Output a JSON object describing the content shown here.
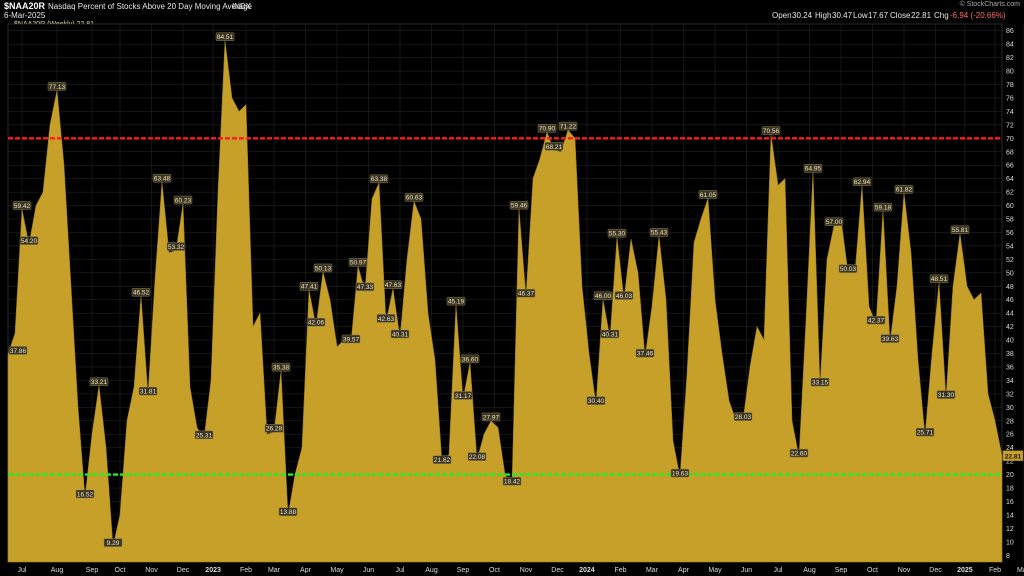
{
  "header": {
    "symbol": "$NAA20R",
    "title": "Nasdaq Percent of Stocks Above 20 Day Moving Average",
    "exchange": "INDX",
    "date": "6-Mar-2025",
    "watermark": "© StockCharts.com",
    "ohlc": {
      "open_label": "Open",
      "open": "30.24",
      "high_label": "High",
      "high": "30.47",
      "low_label": "Low",
      "low": "17.67",
      "close_label": "Close",
      "close": "22.81",
      "chg_label": "Chg",
      "chg": "-6.94 (-20.66%)"
    },
    "legend": "$NAA20R (Weekly) 22.81"
  },
  "chart_data": {
    "type": "area",
    "series": [
      {
        "name": "$NAA20R (Weekly)",
        "color": "#c7a02a",
        "values": [
          37.86,
          41,
          59.42,
          54.2,
          60,
          62,
          72,
          77.13,
          66,
          48,
          30,
          16.52,
          26,
          33.21,
          24,
          9.29,
          14,
          28,
          33,
          46.52,
          31.81,
          49,
          63.48,
          53,
          53.32,
          60.23,
          33,
          27,
          25.31,
          34,
          62,
          84.51,
          76,
          74,
          75,
          42,
          44,
          26,
          26.28,
          35.38,
          13.88,
          20,
          24,
          47.41,
          42.06,
          50.13,
          46,
          39,
          40,
          39.57,
          50.97,
          47.33,
          61,
          63.38,
          42.63,
          47.63,
          40.31,
          52,
          60.63,
          58,
          44,
          37,
          21.62,
          23,
          45.19,
          31.17,
          36.6,
          22.08,
          26,
          27.97,
          27,
          20,
          18.42,
          59.46,
          46.37,
          64,
          67,
          70.9,
          68.21,
          68,
          71.22,
          70,
          48,
          38,
          30.4,
          46.0,
          40.31,
          55.3,
          46.03,
          55,
          50,
          37.46,
          45,
          55.43,
          46,
          25,
          19.63,
          35,
          54.5,
          58,
          61.05,
          46,
          38,
          31,
          28,
          28.03,
          36,
          42,
          40,
          70.56,
          63,
          64,
          28,
          22.6,
          43,
          64.95,
          33.15,
          52,
          57.0,
          58,
          50.03,
          50,
          62.94,
          45,
          42.37,
          59.18,
          39.63,
          48,
          61.82,
          53,
          37,
          25.71,
          38,
          48.51,
          31.3,
          48,
          55.81,
          48,
          46,
          47,
          32,
          28,
          22.81
        ]
      }
    ],
    "data_labels": [
      {
        "i": 0,
        "v": "37.86"
      },
      {
        "i": 2,
        "v": "59.42"
      },
      {
        "i": 3,
        "v": "54.20"
      },
      {
        "i": 7,
        "v": "77.13"
      },
      {
        "i": 11,
        "v": "16.52"
      },
      {
        "i": 13,
        "v": "33.21"
      },
      {
        "i": 15,
        "v": "9.29"
      },
      {
        "i": 19,
        "v": "46.52"
      },
      {
        "i": 20,
        "v": "31.81"
      },
      {
        "i": 22,
        "v": "63.48"
      },
      {
        "i": 24,
        "v": "53.32"
      },
      {
        "i": 25,
        "v": "60.23"
      },
      {
        "i": 28,
        "v": "25.31"
      },
      {
        "i": 31,
        "v": "84.51"
      },
      {
        "i": 38,
        "v": "26.28"
      },
      {
        "i": 39,
        "v": "35.38"
      },
      {
        "i": 40,
        "v": "13.88"
      },
      {
        "i": 43,
        "v": "47.41"
      },
      {
        "i": 44,
        "v": "42.06"
      },
      {
        "i": 45,
        "v": "50.13"
      },
      {
        "i": 49,
        "v": "39.57"
      },
      {
        "i": 50,
        "v": "50.97"
      },
      {
        "i": 51,
        "v": "47.33"
      },
      {
        "i": 53,
        "v": "63.38"
      },
      {
        "i": 54,
        "v": "42.63"
      },
      {
        "i": 55,
        "v": "47.63"
      },
      {
        "i": 56,
        "v": "40.31"
      },
      {
        "i": 58,
        "v": "60.63"
      },
      {
        "i": 62,
        "v": "21.62"
      },
      {
        "i": 64,
        "v": "45.19"
      },
      {
        "i": 65,
        "v": "31.17"
      },
      {
        "i": 66,
        "v": "36.60"
      },
      {
        "i": 67,
        "v": "22.08"
      },
      {
        "i": 69,
        "v": "27.97"
      },
      {
        "i": 72,
        "v": "18.42"
      },
      {
        "i": 73,
        "v": "59.46"
      },
      {
        "i": 74,
        "v": "46.37"
      },
      {
        "i": 77,
        "v": "70.90"
      },
      {
        "i": 78,
        "v": "68.21"
      },
      {
        "i": 80,
        "v": "71.22"
      },
      {
        "i": 84,
        "v": "30.40"
      },
      {
        "i": 85,
        "v": "46.00"
      },
      {
        "i": 86,
        "v": "40.31"
      },
      {
        "i": 87,
        "v": "55.30"
      },
      {
        "i": 88,
        "v": "46.03"
      },
      {
        "i": 91,
        "v": "37.46"
      },
      {
        "i": 93,
        "v": "55.43"
      },
      {
        "i": 96,
        "v": "19.63"
      },
      {
        "i": 100,
        "v": "61.05"
      },
      {
        "i": 105,
        "v": "28.03"
      },
      {
        "i": 109,
        "v": "70.56"
      },
      {
        "i": 113,
        "v": "22.60"
      },
      {
        "i": 115,
        "v": "64.95"
      },
      {
        "i": 116,
        "v": "33.15"
      },
      {
        "i": 118,
        "v": "57.00"
      },
      {
        "i": 120,
        "v": "50.03"
      },
      {
        "i": 122,
        "v": "62.94"
      },
      {
        "i": 124,
        "v": "42.37"
      },
      {
        "i": 125,
        "v": "59.18"
      },
      {
        "i": 126,
        "v": "39.63"
      },
      {
        "i": 128,
        "v": "61.82"
      },
      {
        "i": 131,
        "v": "25.71"
      },
      {
        "i": 133,
        "v": "48.51"
      },
      {
        "i": 134,
        "v": "31.30"
      },
      {
        "i": 136,
        "v": "55.81"
      }
    ],
    "last_value_label": "22.81",
    "x_ticks": [
      {
        "label": "Jul",
        "i": 2
      },
      {
        "label": "Aug",
        "i": 7
      },
      {
        "label": "Sep",
        "i": 12
      },
      {
        "label": "Oct",
        "i": 16
      },
      {
        "label": "Nov",
        "i": 20.5
      },
      {
        "label": "Dec",
        "i": 25
      },
      {
        "label": "2023",
        "i": 29.3,
        "bold": true
      },
      {
        "label": "Feb",
        "i": 34
      },
      {
        "label": "Mar",
        "i": 38
      },
      {
        "label": "Apr",
        "i": 42.5
      },
      {
        "label": "May",
        "i": 47
      },
      {
        "label": "Jun",
        "i": 51.5
      },
      {
        "label": "Jul",
        "i": 56
      },
      {
        "label": "Aug",
        "i": 60.5
      },
      {
        "label": "Sep",
        "i": 65
      },
      {
        "label": "Oct",
        "i": 69.5
      },
      {
        "label": "Nov",
        "i": 74
      },
      {
        "label": "Dec",
        "i": 78.5
      },
      {
        "label": "2024",
        "i": 82.7,
        "bold": true
      },
      {
        "label": "Feb",
        "i": 87.5
      },
      {
        "label": "Mar",
        "i": 92
      },
      {
        "label": "Apr",
        "i": 96.5
      },
      {
        "label": "May",
        "i": 101
      },
      {
        "label": "Jun",
        "i": 105.5
      },
      {
        "label": "Jul",
        "i": 110
      },
      {
        "label": "Aug",
        "i": 114.5
      },
      {
        "label": "Sep",
        "i": 119
      },
      {
        "label": "Oct",
        "i": 123.5
      },
      {
        "label": "Nov",
        "i": 128
      },
      {
        "label": "Dec",
        "i": 132.5
      },
      {
        "label": "2025",
        "i": 136.7,
        "bold": true
      },
      {
        "label": "Feb",
        "i": 141
      },
      {
        "label": "Mar",
        "i": 145
      }
    ],
    "y_ticks": [
      8,
      10,
      12,
      14,
      16,
      18,
      20,
      22,
      24,
      26,
      28,
      30,
      32,
      34,
      36,
      38,
      40,
      42,
      44,
      46,
      48,
      50,
      52,
      54,
      56,
      58,
      60,
      62,
      64,
      66,
      68,
      70,
      72,
      74,
      76,
      78,
      80,
      82,
      84,
      86
    ],
    "ylim": [
      7,
      87
    ],
    "reference_lines": [
      {
        "value": 70,
        "color": "#ff1a1a"
      },
      {
        "value": 20,
        "color": "#22ee22"
      }
    ],
    "colors": {
      "background": "#000000",
      "area": "#c7a02a",
      "grid": "#2a2a2a",
      "label_text": "#dcdcdc"
    },
    "grid": true
  }
}
